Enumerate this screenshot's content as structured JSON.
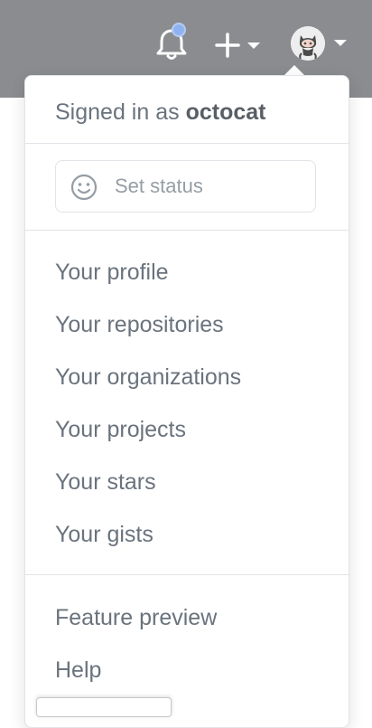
{
  "header": {
    "notifications_icon": "bell-icon",
    "create_icon": "plus-icon",
    "avatar_icon": "octocat-avatar"
  },
  "dropdown": {
    "signed_in_prefix": "Signed in as",
    "username": "octocat",
    "status": {
      "icon": "smiley-icon",
      "label": "Set status"
    },
    "items": [
      {
        "label": "Your profile"
      },
      {
        "label": "Your repositories"
      },
      {
        "label": "Your organizations"
      },
      {
        "label": "Your projects"
      },
      {
        "label": "Your stars"
      },
      {
        "label": "Your gists"
      }
    ],
    "secondary_items": [
      {
        "label": "Feature preview"
      },
      {
        "label": "Help"
      }
    ]
  },
  "colors": {
    "header_bg": "#8a8c8f",
    "notification_dot": "#8fb3f0",
    "menu_text": "#6a737d",
    "divider": "#e1e4e8"
  }
}
